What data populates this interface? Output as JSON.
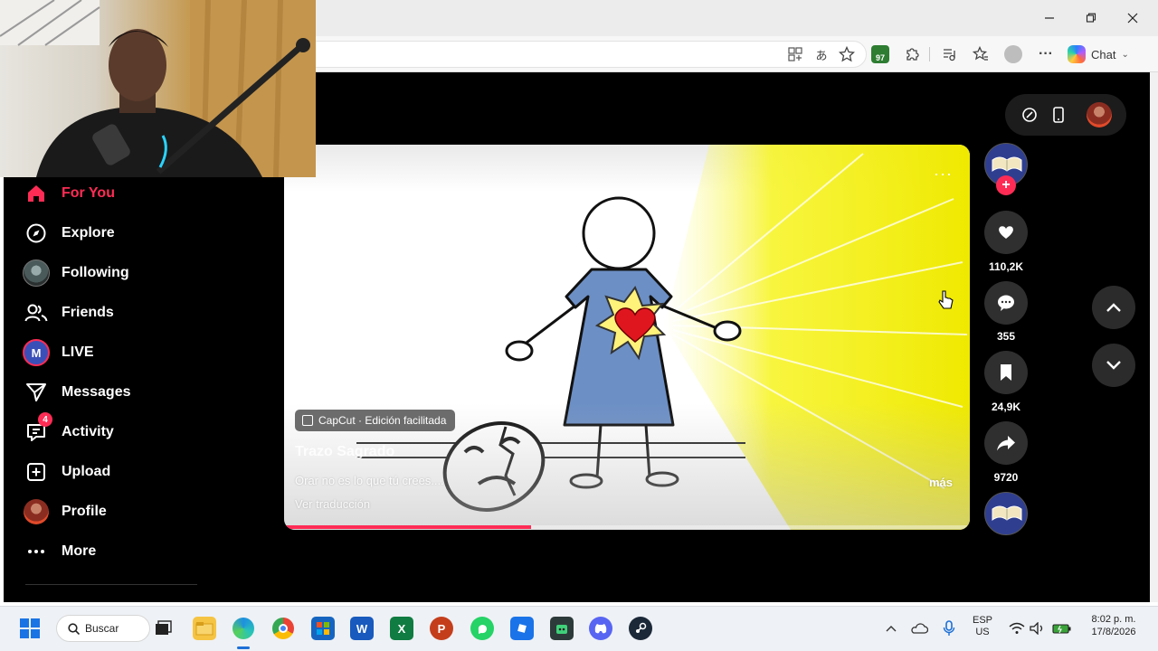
{
  "browser": {
    "chat_label": "Chat",
    "extension_badge": "97",
    "window_controls": {
      "minimize": "minimize-icon",
      "restore": "restore-icon",
      "close": "close-icon"
    }
  },
  "sidebar": {
    "items": [
      {
        "label": "For You",
        "icon": "home-icon",
        "active": true
      },
      {
        "label": "Explore",
        "icon": "compass-icon"
      },
      {
        "label": "Following",
        "icon": "avatar-icon"
      },
      {
        "label": "Friends",
        "icon": "friends-icon"
      },
      {
        "label": "LIVE",
        "icon": "live-avatar-icon"
      },
      {
        "label": "Messages",
        "icon": "paper-plane-icon"
      },
      {
        "label": "Activity",
        "icon": "activity-icon",
        "badge": "4"
      },
      {
        "label": "Upload",
        "icon": "upload-icon"
      },
      {
        "label": "Profile",
        "icon": "profile-avatar-icon"
      },
      {
        "label": "More",
        "icon": "more-icon"
      }
    ]
  },
  "video": {
    "capcut_tag": "CapCut · Edición facilitada",
    "author": "Trazo Sagrado",
    "caption": "Orar no es lo que tú crees....",
    "translate": "Ver traducción",
    "more": "más",
    "progress": 0.36
  },
  "actions": {
    "likes": "110,2K",
    "comments": "355",
    "saves": "24,9K",
    "shares": "9720"
  },
  "taskbar": {
    "search_label": "Buscar",
    "language_top": "ESP",
    "language_bottom": "US",
    "time": "8:02 p. m.",
    "date": "17/8/2026"
  },
  "colors": {
    "accent": "#fe2c55",
    "page_bg": "#000000",
    "light_yellow": "#f5f200"
  }
}
